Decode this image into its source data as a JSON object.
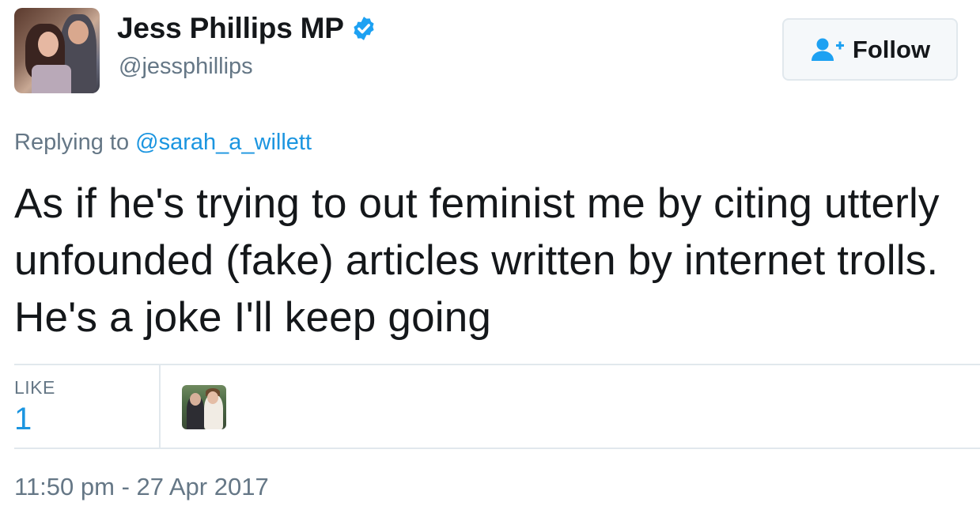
{
  "author": {
    "name": "Jess Phillips MP",
    "handle": "@jessphillips",
    "verified": true,
    "avatar_icon": "profile-photo-avatar"
  },
  "follow_button": {
    "label": "Follow",
    "icon": "add-user-icon"
  },
  "reply": {
    "prefix": "Replying to",
    "mention": "@sarah_a_willett"
  },
  "tweet": {
    "text": "As if he's trying to out feminist me by citing utterly unfounded (fake) articles written by internet trolls. He's a joke I'll keep going"
  },
  "stats": {
    "like_label": "LIKE",
    "like_count": "1",
    "liker_avatar_icon": "liker-profile-photo"
  },
  "timestamp": "11:50 pm - 27 Apr 2017",
  "colors": {
    "text": "#14171a",
    "muted": "#657786",
    "link": "#1b95e0",
    "verified": "#1da1f2",
    "border": "#e1e8ed"
  }
}
